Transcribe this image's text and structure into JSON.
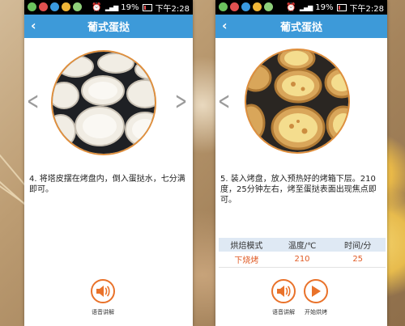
{
  "screens": [
    {
      "status": {
        "battery": "19%",
        "time": "下午2:28"
      },
      "title": "葡式蛋挞",
      "step_text": "4. 将塔皮摆在烤盘内，倒入蛋挞水，七分满即可。",
      "buttons": {
        "voice_label": "语音讲解"
      }
    },
    {
      "status": {
        "battery": "19%",
        "time": "下午2:28"
      },
      "title": "葡式蛋挞",
      "step_text": "5. 装入烤盘，放入预热好的烤箱下层。210度，25分钟左右，烤至蛋挞表面出现焦点即可。",
      "table": {
        "headers": [
          "烘焙模式",
          "温度/℃",
          "时间/分"
        ],
        "row": [
          "下烧烤",
          "210",
          "25"
        ]
      },
      "buttons": {
        "voice_label": "语音讲解",
        "start_label": "开始烘烤"
      }
    }
  ],
  "colors": {
    "accent": "#3d9ad9",
    "button": "#e9722a",
    "highlight": "#e05b25"
  },
  "icons": [
    "back-icon",
    "prev-arrow-icon",
    "next-arrow-icon",
    "speaker-icon",
    "play-icon"
  ]
}
